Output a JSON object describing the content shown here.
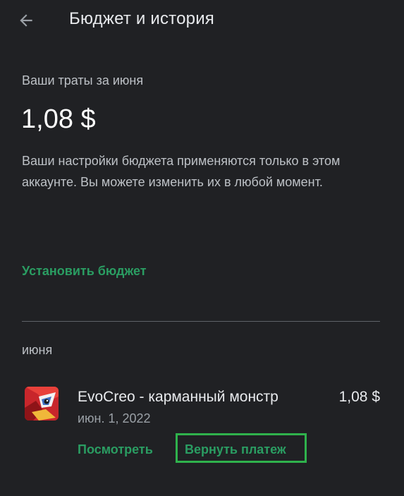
{
  "header": {
    "title": "Бюджет и история"
  },
  "summary": {
    "spent_label": "Ваши траты за июня",
    "spent_amount": "1,08 $",
    "note": "Ваши настройки бюджета применяются только в этом аккаунте. Вы можете изменить их в любой момент."
  },
  "actions": {
    "set_budget_label": "Установить бюджет"
  },
  "history": {
    "month": "июня",
    "items": [
      {
        "name": "EvoCreo - карманный монстр",
        "date": "июн. 1, 2022",
        "price": "1,08 $",
        "view_label": "Посмотреть",
        "refund_label": "Вернуть платеж"
      }
    ]
  },
  "colors": {
    "background": "#202124",
    "accent": "#2a9d62",
    "highlight_border": "#2fb24c"
  }
}
